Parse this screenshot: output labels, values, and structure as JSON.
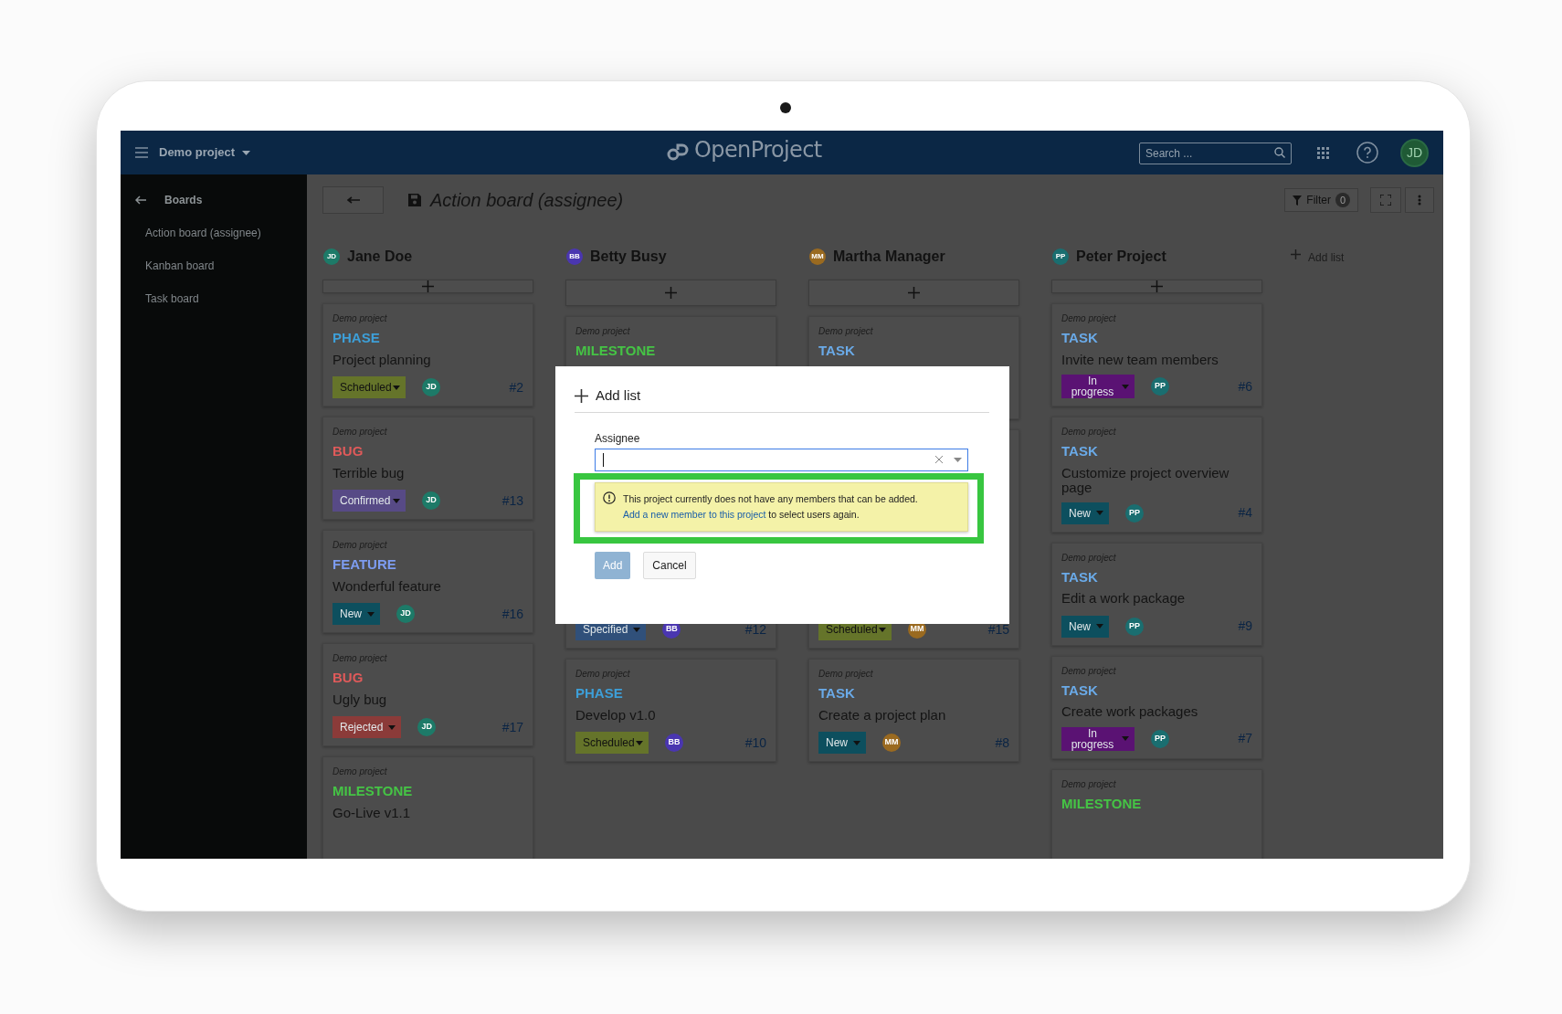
{
  "header": {
    "project": "Demo project",
    "logo": "OpenProject",
    "search": {
      "placeholder": "Search ..."
    },
    "user_initials": "JD"
  },
  "sidebar": {
    "back_label": "Boards",
    "items": [
      {
        "label": "Action board (assignee)"
      },
      {
        "label": "Kanban board"
      },
      {
        "label": "Task board"
      }
    ]
  },
  "board": {
    "title": "Action board (assignee)",
    "filter": {
      "label": "Filter",
      "count": "0"
    },
    "add_list": "Add list",
    "columns": [
      {
        "name": "Jane Doe",
        "initials": "JD",
        "color": "#1d7a68",
        "cards": [
          {
            "project": "Demo project",
            "type": {
              "label": "PHASE",
              "color": "#3d9fd8"
            },
            "title": "Project planning",
            "status": {
              "label": "Scheduled",
              "color": "#65742a"
            },
            "assignee": "JD",
            "number": "#2"
          },
          {
            "project": "Demo project",
            "type": {
              "label": "BUG",
              "color": "#e05a5a"
            },
            "title": "Terrible bug",
            "status": {
              "label": "Confirmed",
              "color": "#574a86"
            },
            "assignee": "JD",
            "number": "#13"
          },
          {
            "project": "Demo project",
            "type": {
              "label": "FEATURE",
              "color": "#7d9cf0"
            },
            "title": "Wonderful feature",
            "status": {
              "label": "New",
              "color": "#0d4f5e"
            },
            "assignee": "JD",
            "number": "#16"
          },
          {
            "project": "Demo project",
            "type": {
              "label": "BUG",
              "color": "#e05a5a"
            },
            "title": "Ugly bug",
            "status": {
              "label": "Rejected",
              "color": "#8b3b39"
            },
            "assignee": "JD",
            "number": "#17"
          },
          {
            "project": "Demo project",
            "type": {
              "label": "MILESTONE",
              "color": "#45c445"
            },
            "title": "Go-Live v1.1"
          }
        ]
      },
      {
        "name": "Betty Busy",
        "initials": "BB",
        "color": "#4a36b0",
        "cards": [
          {
            "project": "Demo project",
            "type": {
              "label": "MILESTONE",
              "color": "#45c445"
            }
          },
          {
            "status": {
              "label": "Specified",
              "color": "#30507a"
            },
            "assignee": "BB",
            "number": "#12"
          },
          {
            "project": "Demo project",
            "type": {
              "label": "PHASE",
              "color": "#3d9fd8"
            },
            "title": "Develop v1.0",
            "status": {
              "label": "Scheduled",
              "color": "#65742a"
            },
            "assignee": "BB",
            "number": "#10"
          }
        ]
      },
      {
        "name": "Martha Manager",
        "initials": "MM",
        "color": "#9a6a20",
        "cards": [
          {
            "project": "Demo project",
            "type": {
              "label": "TASK",
              "color": "#6aaae8"
            }
          },
          {
            "status": {
              "label": "Scheduled",
              "color": "#65742a"
            },
            "assignee": "MM",
            "number": "#15"
          },
          {
            "project": "Demo project",
            "type": {
              "label": "TASK",
              "color": "#6aaae8"
            },
            "title": "Create a project plan",
            "status": {
              "label": "New",
              "color": "#0d4f5e"
            },
            "assignee": "MM",
            "number": "#8"
          }
        ]
      },
      {
        "name": "Peter Project",
        "initials": "PP",
        "color": "#1a6e70",
        "cards": [
          {
            "project": "Demo project",
            "type": {
              "label": "TASK",
              "color": "#6aaae8"
            },
            "title": "Invite new team members",
            "status": {
              "label": "In progress",
              "color": "#5a1273"
            },
            "assignee": "PP",
            "number": "#6"
          },
          {
            "project": "Demo project",
            "type": {
              "label": "TASK",
              "color": "#6aaae8"
            },
            "title": "Customize project overview page",
            "status": {
              "label": "New",
              "color": "#0d4f5e"
            },
            "assignee": "PP",
            "number": "#4"
          },
          {
            "project": "Demo project",
            "type": {
              "label": "TASK",
              "color": "#6aaae8"
            },
            "title": "Edit a work package",
            "status": {
              "label": "New",
              "color": "#0d4f5e"
            },
            "assignee": "PP",
            "number": "#9"
          },
          {
            "project": "Demo project",
            "type": {
              "label": "TASK",
              "color": "#6aaae8"
            },
            "title": "Create work packages",
            "status": {
              "label": "In progress",
              "color": "#5a1273"
            },
            "assignee": "PP",
            "number": "#7"
          },
          {
            "project": "Demo project",
            "type": {
              "label": "MILESTONE",
              "color": "#45c445"
            }
          }
        ]
      }
    ]
  },
  "modal": {
    "title": "Add list",
    "field": {
      "label": "Assignee",
      "focused": true
    },
    "warning": {
      "text": "This project currently does not have any members that can be added.",
      "link": "Add a new member to this project",
      "after": " to select users again."
    },
    "buttons": [
      {
        "label": "Add",
        "disabled": true
      },
      {
        "label": "Cancel",
        "disabled": false
      }
    ]
  }
}
